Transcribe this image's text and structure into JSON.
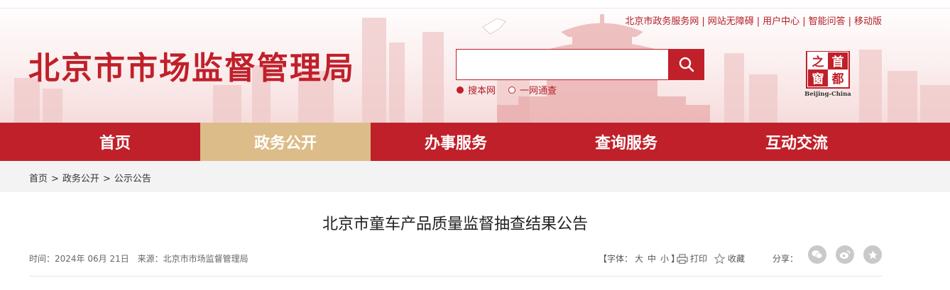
{
  "header": {
    "site_title": "北京市市场监督管理局",
    "top_links": [
      "北京市政务服务网",
      "网站无障碍",
      "用户中心",
      "智能问答",
      "移动版"
    ],
    "search": {
      "placeholder": "",
      "scope_options": [
        "搜本网",
        "一网通查"
      ],
      "selected_scope": "搜本网"
    },
    "seal": {
      "text": "首都之窗",
      "subtitle": "Beijing-China"
    },
    "colors": {
      "brand_red": "#c0202a",
      "active_nav_gold": "#dcbc88"
    }
  },
  "nav": {
    "items": [
      "首页",
      "政务公开",
      "办事服务",
      "查询服务",
      "互动交流"
    ],
    "active": "政务公开"
  },
  "breadcrumb": {
    "items": [
      "首页",
      "政务公开",
      "公示公告"
    ]
  },
  "article": {
    "title": "北京市童车产品质量监督抽查结果公告",
    "time_label": "时间：",
    "time_value": "2024年 06月 21日",
    "source_label": "来源：",
    "source_value": "北京市市场监督管理局",
    "font_size_label": "【字体：",
    "font_size_options": [
      "大",
      "中",
      "小"
    ],
    "font_size_close": "】",
    "print_label": "打印",
    "favorite_label": "收藏",
    "share_label": "分享：",
    "share_icons": [
      "wechat-icon",
      "weibo-icon",
      "star-share-icon"
    ]
  }
}
